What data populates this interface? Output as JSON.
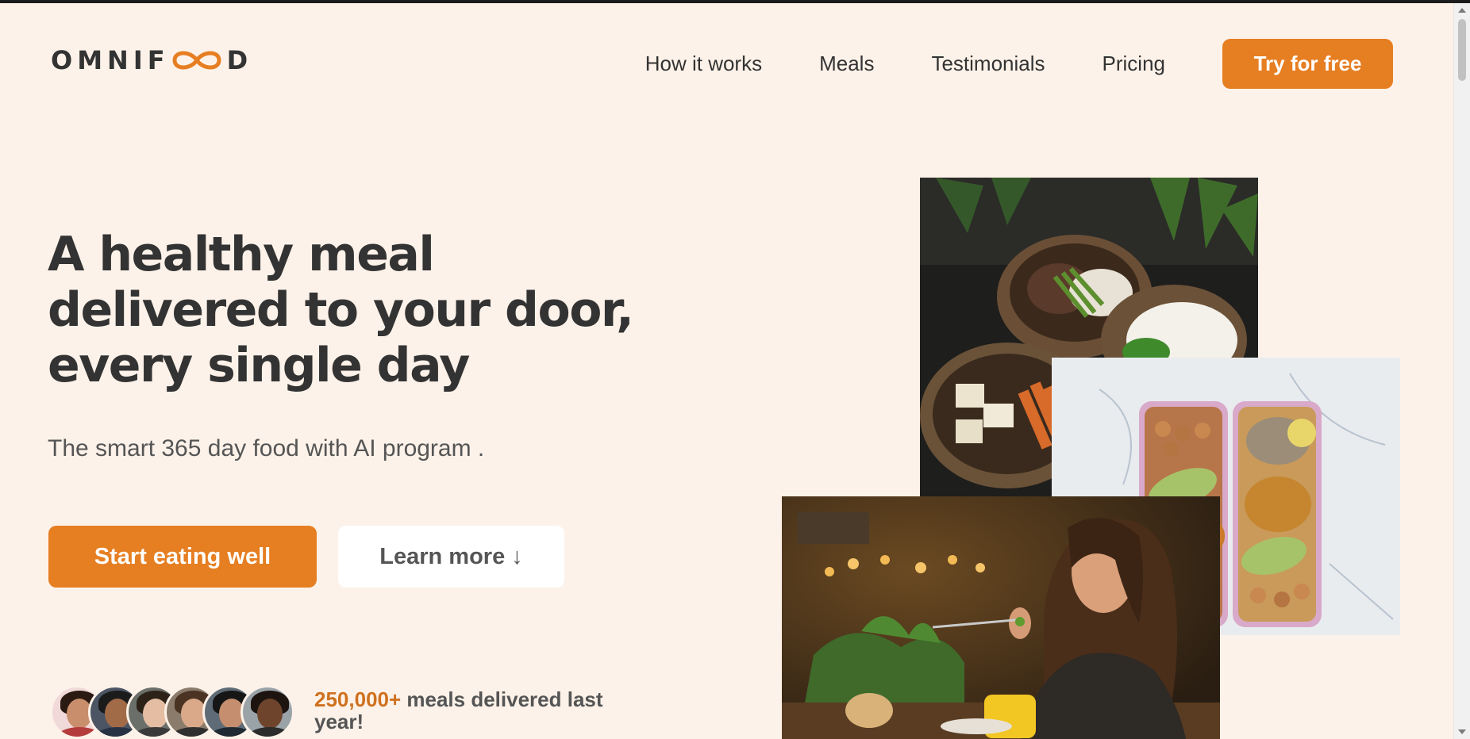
{
  "header": {
    "logo_text": "OMNIFOOD",
    "logo_before": "OMNIF",
    "logo_after": "D",
    "nav": [
      "How it works",
      "Meals",
      "Testimonials",
      "Pricing"
    ],
    "cta_label": "Try for free"
  },
  "hero": {
    "title": "A healthy meal delivered to your door, every single day",
    "subtitle": "The smart 365 day food with AI program .",
    "primary_button": "Start eating well",
    "secondary_button": "Learn more",
    "secondary_icon": "arrow-down-icon"
  },
  "delivered": {
    "count": "250,000+",
    "text": " meals delivered last year!"
  },
  "colors": {
    "accent": "#e67e22",
    "background": "#fdf2e9",
    "text": "#333333"
  }
}
